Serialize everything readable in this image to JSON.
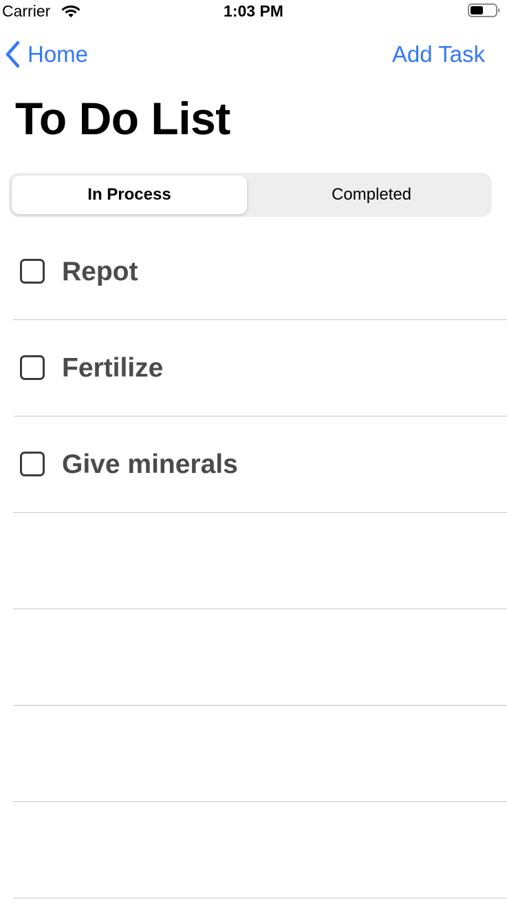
{
  "status_bar": {
    "carrier": "Carrier",
    "time": "1:03 PM",
    "icons": [
      "wifi-icon",
      "battery-icon"
    ]
  },
  "nav": {
    "back_label": "Home",
    "action_label": "Add Task",
    "accent_color": "#3478f6"
  },
  "page": {
    "title": "To Do List"
  },
  "segments": {
    "in_process": "In Process",
    "completed": "Completed",
    "selected": "In Process"
  },
  "tasks": [
    {
      "label": "Repot",
      "checked": false
    },
    {
      "label": "Fertilize",
      "checked": false
    },
    {
      "label": "Give minerals",
      "checked": false
    }
  ],
  "empty_rows": 4
}
